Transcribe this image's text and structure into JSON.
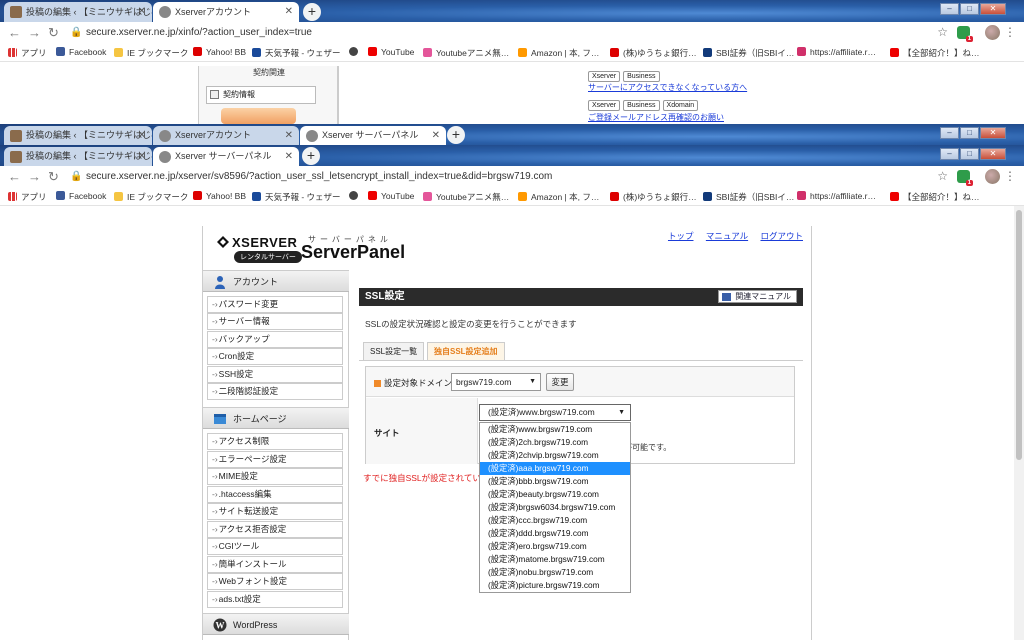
{
  "window_back": {
    "tabs": [
      {
        "title": "投稿の編集 ‹ 【ミニウサギはじめ"
      },
      {
        "title": "Xserverアカウント"
      }
    ],
    "address": "secure.xserver.ne.jp/xinfo/?action_user_index=true"
  },
  "window_mid": {
    "tabs": [
      {
        "title": "投稿の編集 ‹ 【ミニウサギはじめ"
      },
      {
        "title": "Xserverアカウント"
      },
      {
        "title": "Xserver サーバーパネル"
      }
    ]
  },
  "window_front": {
    "tabs": [
      {
        "title": "投稿の編集 ‹ 【ミニウサギはじめ"
      },
      {
        "title": "Xserver サーバーパネル"
      }
    ],
    "address": "secure.xserver.ne.jp/xserver/sv8596/?action_user_ssl_letsencrypt_install_index=true&did=brgsw719.com"
  },
  "window_controls": {
    "minimize": "–",
    "maximize": "□",
    "close": "✕"
  },
  "bookmarks": [
    {
      "label": "アプリ"
    },
    {
      "label": "Facebook"
    },
    {
      "label": "IE ブックマーク"
    },
    {
      "label": "Yahoo! BB"
    },
    {
      "label": "天気予報 - ウェザー"
    },
    {
      "label": ""
    },
    {
      "label": "YouTube"
    },
    {
      "label": "Youtubeアニメ無…"
    },
    {
      "label": "Amazon | 本, フ…"
    },
    {
      "label": "(株)ゆうちょ銀行…"
    },
    {
      "label": "SBI証券（旧SBIイ…"
    },
    {
      "label": "https://affiliate.r…"
    },
    {
      "label": "【全部紹介！】ね…"
    }
  ],
  "bg_page": {
    "keiyaku_heading": "契約関連",
    "keiyaku_item": "契約情報",
    "tags1": [
      "Xserver",
      "Business"
    ],
    "link1": "サーバーにアクセスできなくなっている方へ",
    "tags2": [
      "Xserver",
      "Business",
      "Xdomain"
    ],
    "link2": "ご登録メールアドレス再確認のお願い"
  },
  "panel": {
    "logo_brand": "XSERVER",
    "logo_rental": "レンタルサーバー",
    "logo_sub": "サーバーパネル",
    "logo_main": "ServerPanel",
    "toplinks": [
      "トップ",
      "マニュアル",
      "ログアウト"
    ],
    "sidebar": {
      "account_heading": "アカウント",
      "account_items": [
        "パスワード変更",
        "サーバー情報",
        "バックアップ",
        "Cron設定",
        "SSH設定",
        "二段階認証設定"
      ],
      "home_heading": "ホームページ",
      "home_items": [
        "アクセス制限",
        "エラーページ設定",
        "MIME設定",
        ".htaccess編集",
        "サイト転送設定",
        "アクセス拒否設定",
        "CGIツール",
        "簡単インストール",
        "Webフォント設定",
        "ads.txt設定"
      ],
      "wp_heading": "WordPress"
    },
    "ssl_title": "SSL設定",
    "manual_button": "関連マニュアル",
    "description": "SSLの設定状況確認と設定の変更を行うことができます",
    "tabs": [
      "SSL設定一覧",
      "独自SSL設定追加"
    ],
    "domain_label": "設定対象ドメイン",
    "domain_value": "brgsw719.com",
    "change_button": "変更",
    "site_label": "サイト",
    "site_value": "(設定済)www.brgsw719.com",
    "notice_fragment": "が可能です。",
    "error_text": "すでに独自SSLが設定されてい",
    "dropdown_options": [
      "(設定済)www.brgsw719.com",
      "(設定済)2ch.brgsw719.com",
      "(設定済)2chvip.brgsw719.com",
      "(設定済)aaa.brgsw719.com",
      "(設定済)bbb.brgsw719.com",
      "(設定済)beauty.brgsw719.com",
      "(設定済)brgsw6034.brgsw719.com",
      "(設定済)ccc.brgsw719.com",
      "(設定済)ddd.brgsw719.com",
      "(設定済)ero.brgsw719.com",
      "(設定済)matome.brgsw719.com",
      "(設定済)nobu.brgsw719.com",
      "(設定済)picture.brgsw719.com"
    ],
    "dropdown_selected_index": 3
  },
  "colors": {
    "accent_orange": "#e57f1c",
    "link_blue": "#1a3bd8",
    "error_red": "#e02020",
    "selection_blue": "#1e90ff",
    "ssl_header_bg": "#2b2b2b"
  }
}
